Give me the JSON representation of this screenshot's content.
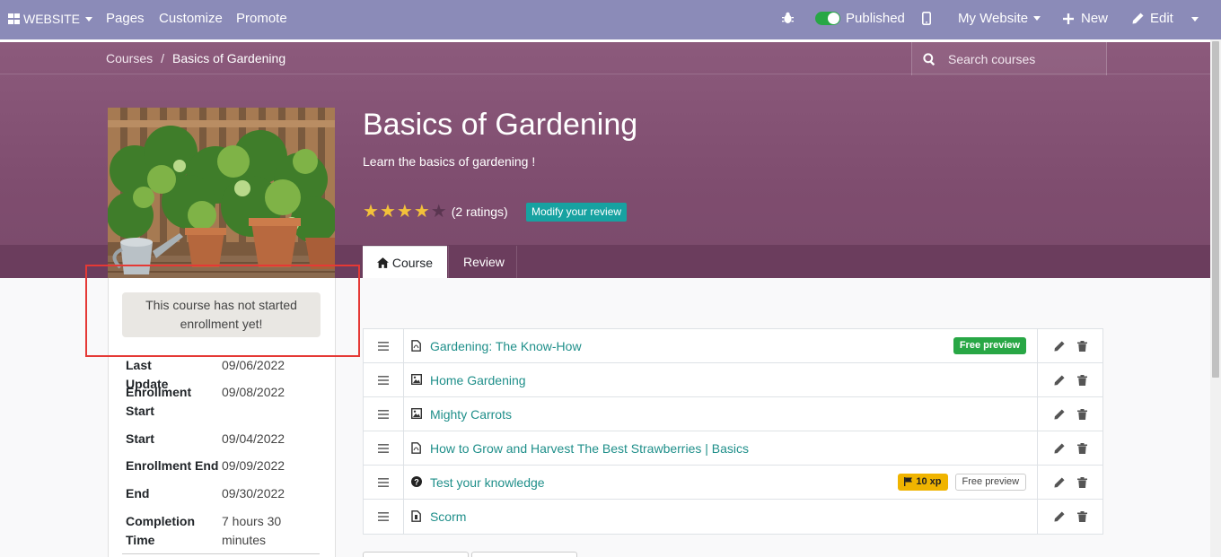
{
  "topnav": {
    "website": "WEBSITE",
    "pages": "Pages",
    "customize": "Customize",
    "promote": "Promote",
    "published": "Published",
    "my_website": "My Website",
    "new": "New",
    "edit": "Edit"
  },
  "breadcrumb": {
    "root": "Courses",
    "separator": "/",
    "current": "Basics of Gardening"
  },
  "search": {
    "placeholder": "Search courses"
  },
  "course": {
    "title": "Basics of Gardening",
    "subtitle": "Learn the basics of gardening !",
    "rating": 4,
    "rating_max": 5,
    "ratings_text": "(2 ratings)",
    "review_button": "Modify your review"
  },
  "tabs": [
    {
      "label": "Course"
    },
    {
      "label": "Review"
    }
  ],
  "sidebar": {
    "notice": "This course has not started enrollment yet!",
    "info": [
      {
        "label": "Last Update",
        "value": "09/06/2022"
      },
      {
        "label": "Enrollment Start",
        "value": "09/08/2022"
      },
      {
        "label": "Start",
        "value": "09/04/2022"
      },
      {
        "label": "Enrollment End",
        "value": "09/09/2022"
      },
      {
        "label": "End",
        "value": "09/30/2022"
      },
      {
        "label": "Completion Time",
        "value": "7 hours 30 minutes"
      }
    ]
  },
  "contents": [
    {
      "title": "Gardening: The Know-How",
      "icon": "pdf-icon",
      "badges": [
        "Free preview"
      ]
    },
    {
      "title": "Home Gardening",
      "icon": "image-icon",
      "badges": []
    },
    {
      "title": "Mighty Carrots",
      "icon": "image-icon",
      "badges": []
    },
    {
      "title": "How to Grow and Harvest The Best Strawberries | Basics",
      "icon": "pdf-icon",
      "badges": []
    },
    {
      "title": "Test your knowledge",
      "icon": "question-icon",
      "xp": "10 xp",
      "badges": [
        "Free preview"
      ]
    },
    {
      "title": "Scorm",
      "icon": "scorm-icon",
      "badges": []
    }
  ],
  "colors": {
    "nav": "#8b8bb8",
    "hero": "#8c5a7c",
    "link": "#1f8f8a",
    "free_preview": "#28a745",
    "xp": "#f0b400",
    "review_button": "#17a2a1",
    "highlight": "#e53935"
  }
}
